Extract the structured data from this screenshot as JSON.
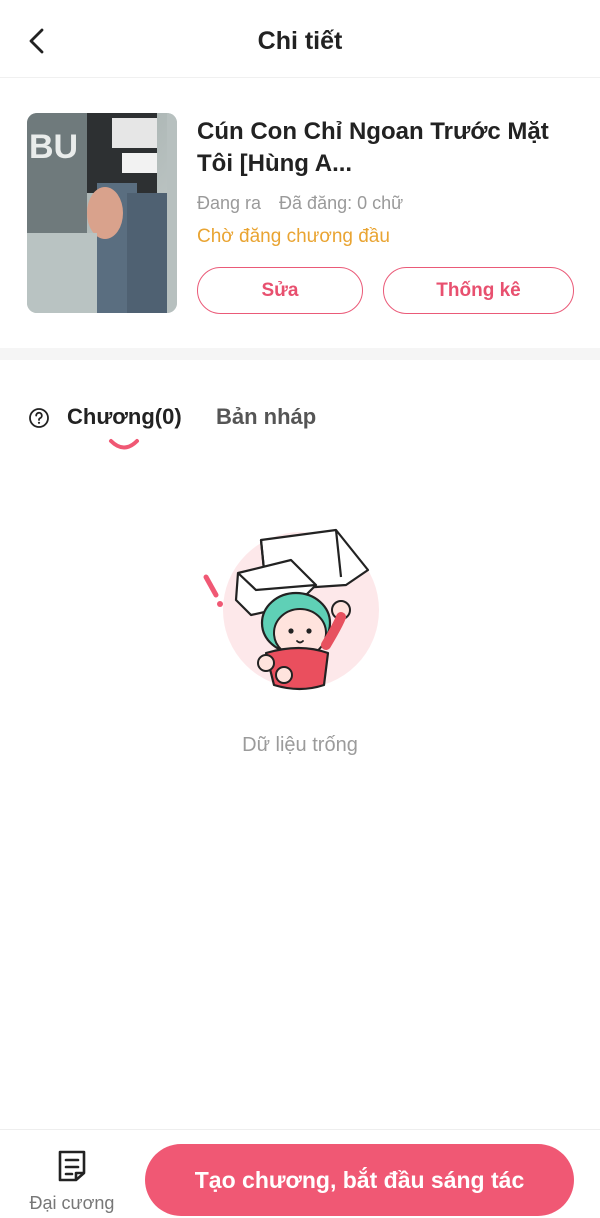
{
  "header": {
    "title": "Chi tiết",
    "back_icon": "chevron-left-icon"
  },
  "book": {
    "title": "Cún Con Chỉ Ngoan Trước Mặt Tôi [Hùng A...",
    "status": "Đang ra",
    "word_count": "Đã đăng: 0 chữ",
    "publish_state": "Chờ đăng chương đầu",
    "edit_label": "Sửa",
    "stats_label": "Thống kê"
  },
  "tabs": {
    "help_icon": "question-circle-icon",
    "chapters_label": "Chương(0)",
    "drafts_label": "Bản nháp",
    "active": "chapters"
  },
  "empty_state": {
    "illustration": "empty-box-character-illustration",
    "message": "Dữ liệu trống"
  },
  "bottom_bar": {
    "outline_icon": "document-list-icon",
    "outline_label": "Đại cương",
    "create_label": "Tạo chương, bắt đầu sáng tác"
  },
  "colors": {
    "accent": "#f05874",
    "accent_text": "#e8506f",
    "pending": "#e9a432",
    "muted": "#9a9a9a"
  }
}
